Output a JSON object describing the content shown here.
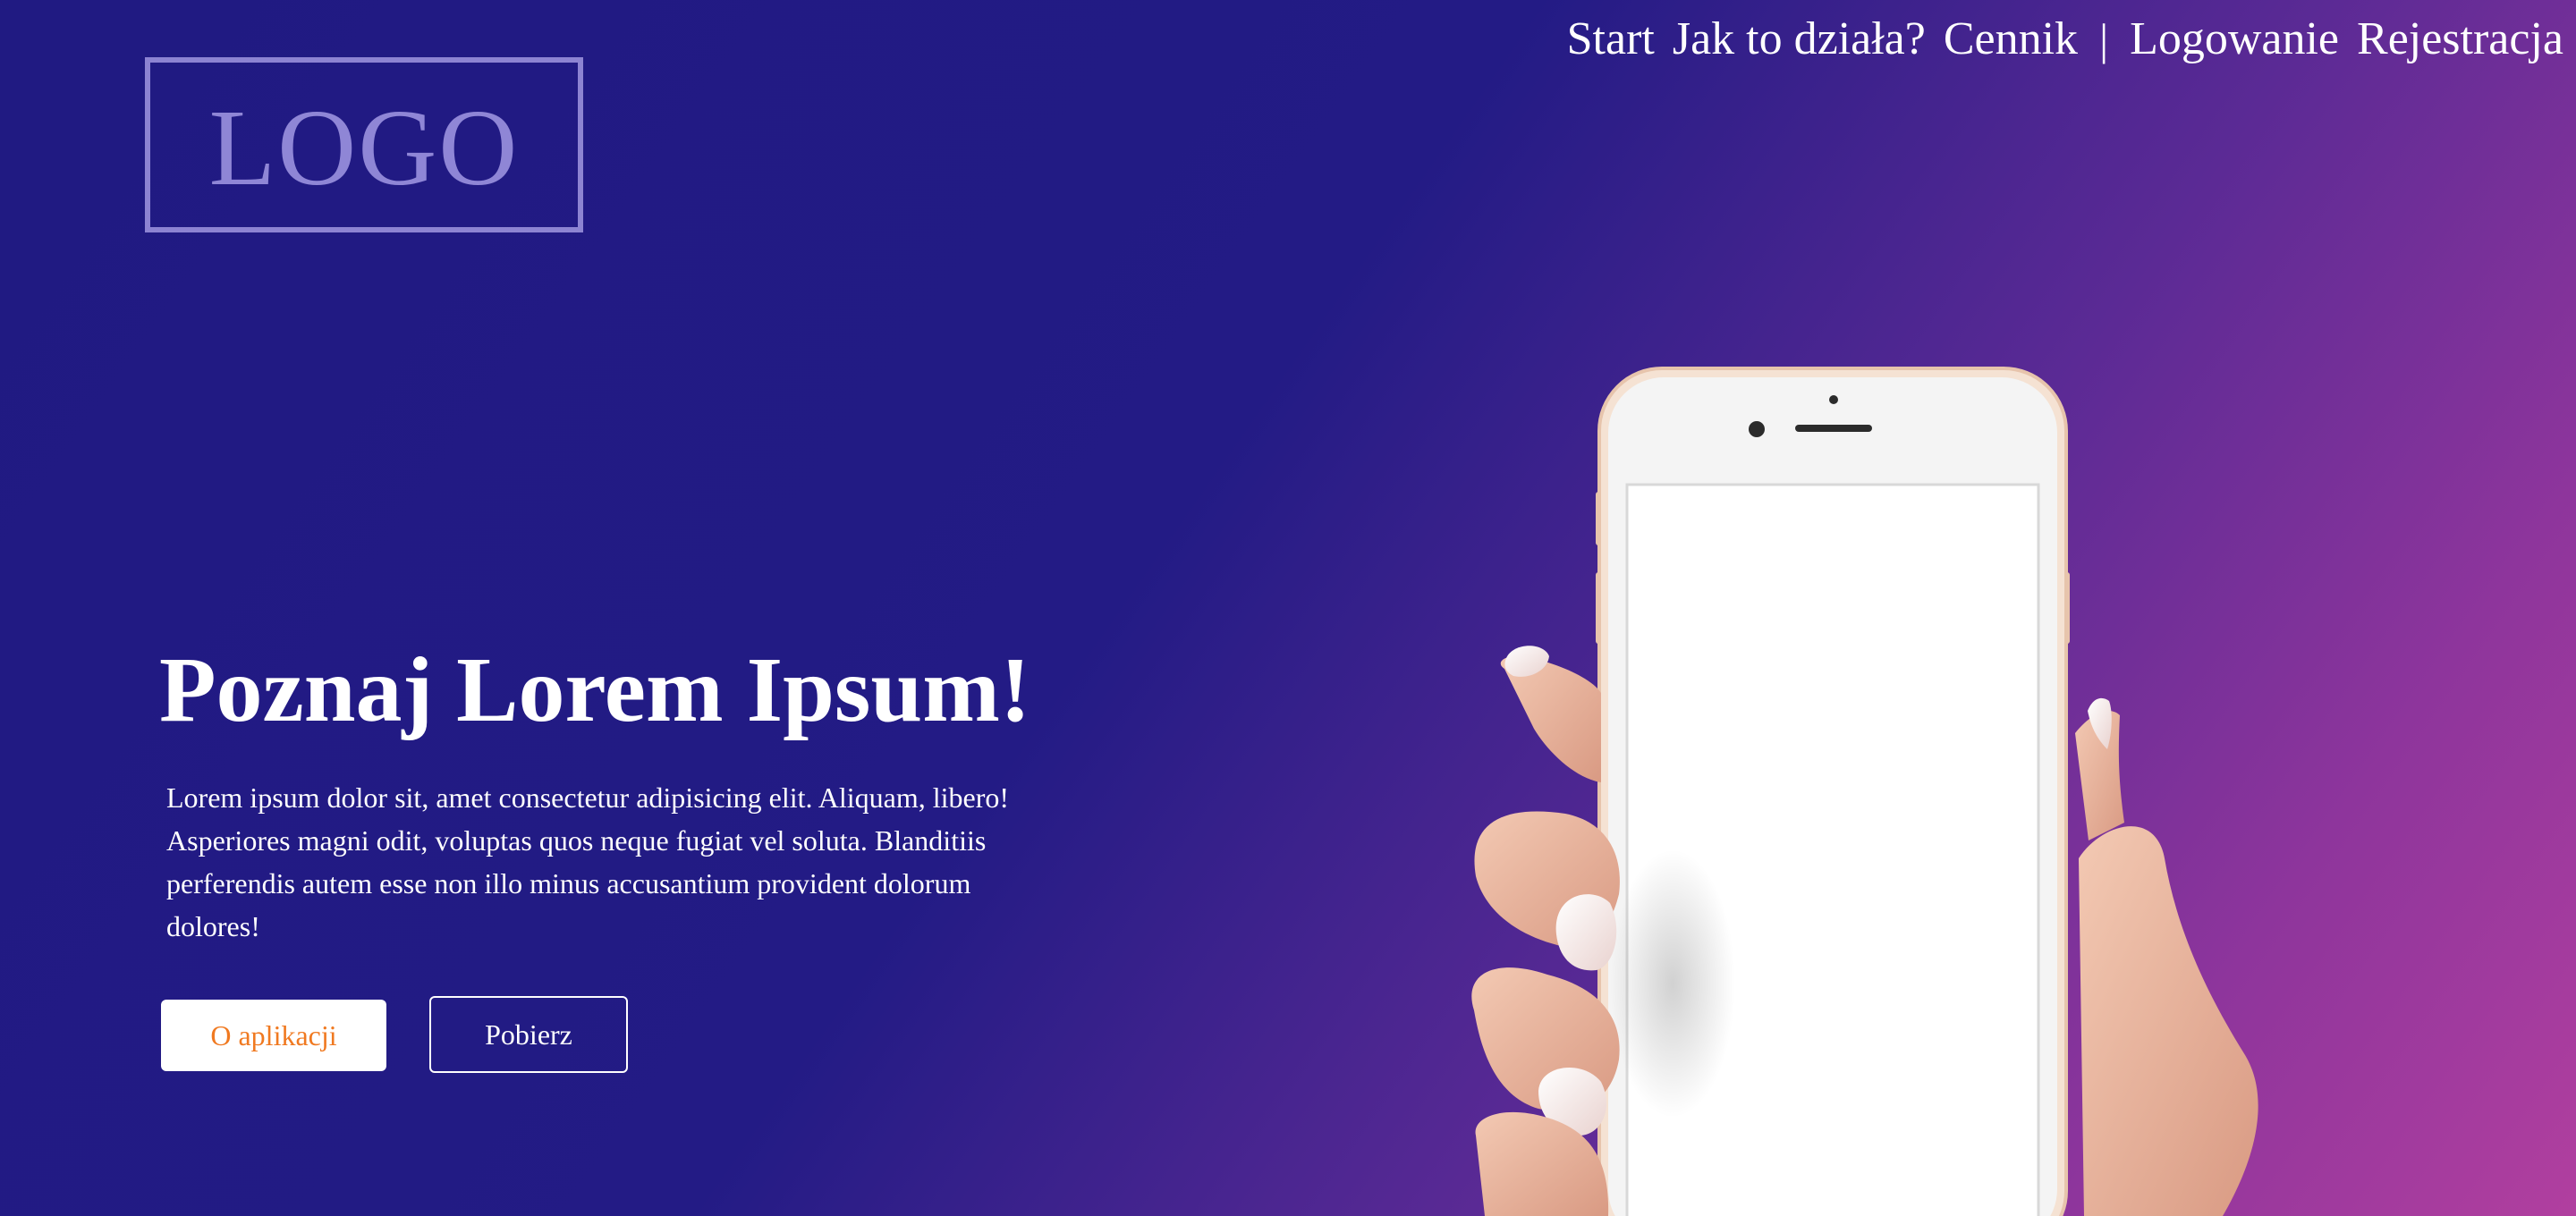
{
  "logo": {
    "text": "LOGO"
  },
  "nav": {
    "items": [
      {
        "label": "Start"
      },
      {
        "label": "Jak to działa?"
      },
      {
        "label": "Cennik"
      }
    ],
    "separator": "|",
    "auth": [
      {
        "label": "Logowanie"
      },
      {
        "label": "Rejestracja"
      }
    ]
  },
  "hero": {
    "title": "Poznaj Lorem Ipsum!",
    "description": "Lorem ipsum dolor sit, amet consectetur adipisicing elit. Aliquam, libero! Asperiores magni odit, voluptas quos neque fugiat vel soluta. Blanditiis perferendis autem esse non illo minus accusantium provident dolorum dolores!",
    "primary_button": "O aplikacji",
    "secondary_button": "Pobierz"
  },
  "colors": {
    "gradient_start": "#201a82",
    "gradient_end": "#b13f9f",
    "primary_button_text": "#f07920",
    "logo": "#8f86d6"
  },
  "illustration": {
    "icon": "hand-holding-smartphone-icon"
  }
}
